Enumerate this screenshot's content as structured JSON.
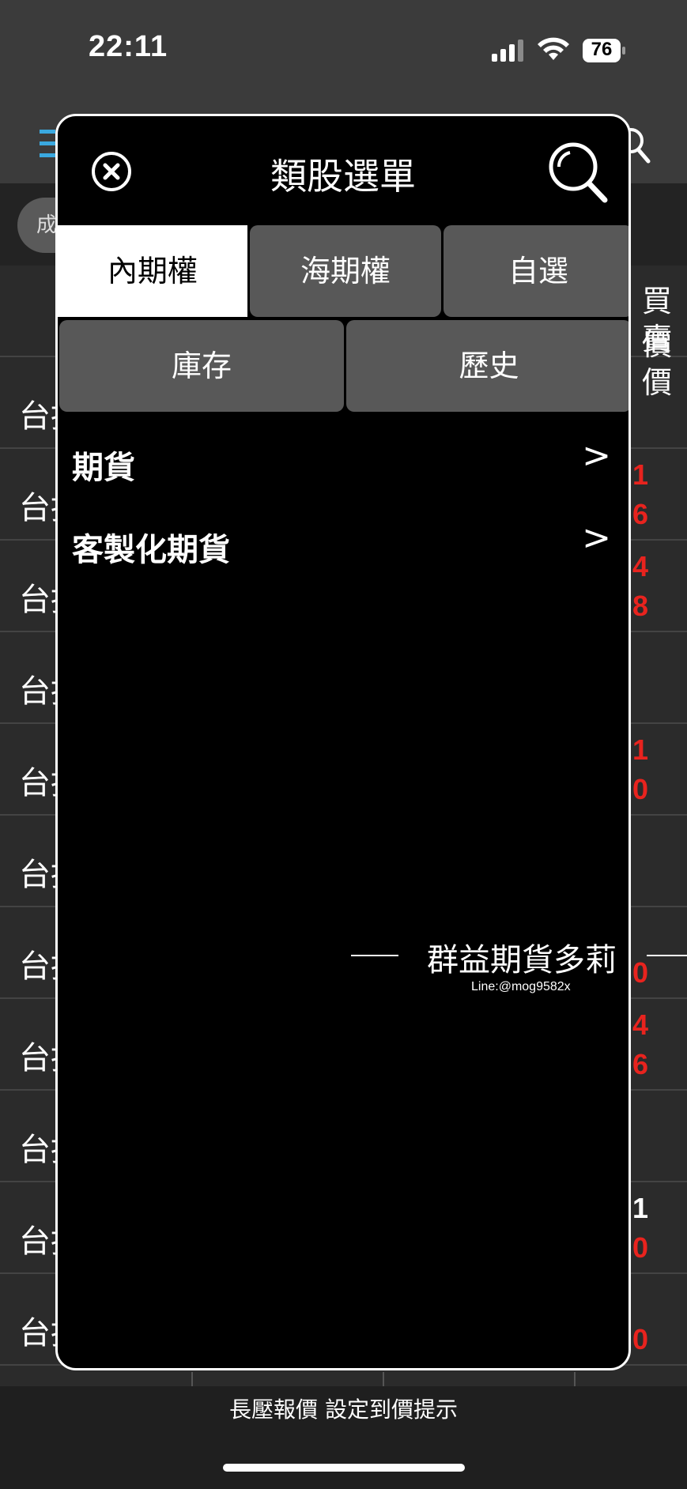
{
  "status_bar": {
    "time": "22:11",
    "battery": "76"
  },
  "background": {
    "filter_chip": "成",
    "column_header": [
      "買價",
      "賣價"
    ],
    "rows": [
      {
        "name": "台指",
        "values": []
      },
      {
        "name": "台指",
        "values": [
          "1",
          "6"
        ]
      },
      {
        "name": "台指",
        "values": [
          "4",
          "8"
        ]
      },
      {
        "name": "台指",
        "values": []
      },
      {
        "name": "台指",
        "values": [
          "1",
          "0"
        ]
      },
      {
        "name": "台指",
        "values": []
      },
      {
        "name": "台指",
        "values": [
          "",
          "0"
        ]
      },
      {
        "name": "台指",
        "values": [
          "4",
          "6"
        ]
      },
      {
        "name": "台指",
        "values": []
      },
      {
        "name": "台指",
        "values": [
          "1",
          "0"
        ]
      },
      {
        "name": "台指",
        "values": [
          "",
          "0"
        ]
      }
    ],
    "bottom_hint": "長壓報價 設定到價提示"
  },
  "modal": {
    "title": "類股選單",
    "tabs_row1": [
      {
        "label": "內期權",
        "active": true
      },
      {
        "label": "海期權",
        "active": false
      },
      {
        "label": "自選",
        "active": false
      }
    ],
    "tabs_row2": [
      {
        "label": "庫存"
      },
      {
        "label": "歷史"
      }
    ],
    "items": [
      {
        "label": "期貨",
        "chevron": ">"
      },
      {
        "label": "客製化期貨",
        "chevron": ">"
      }
    ]
  },
  "watermark": {
    "name": "群益期貨多莉",
    "line": "Line:@mog9582x"
  },
  "colors": {
    "up_red": "#e8231e",
    "tab_gray": "#585858",
    "modal_bg": "#000000"
  }
}
